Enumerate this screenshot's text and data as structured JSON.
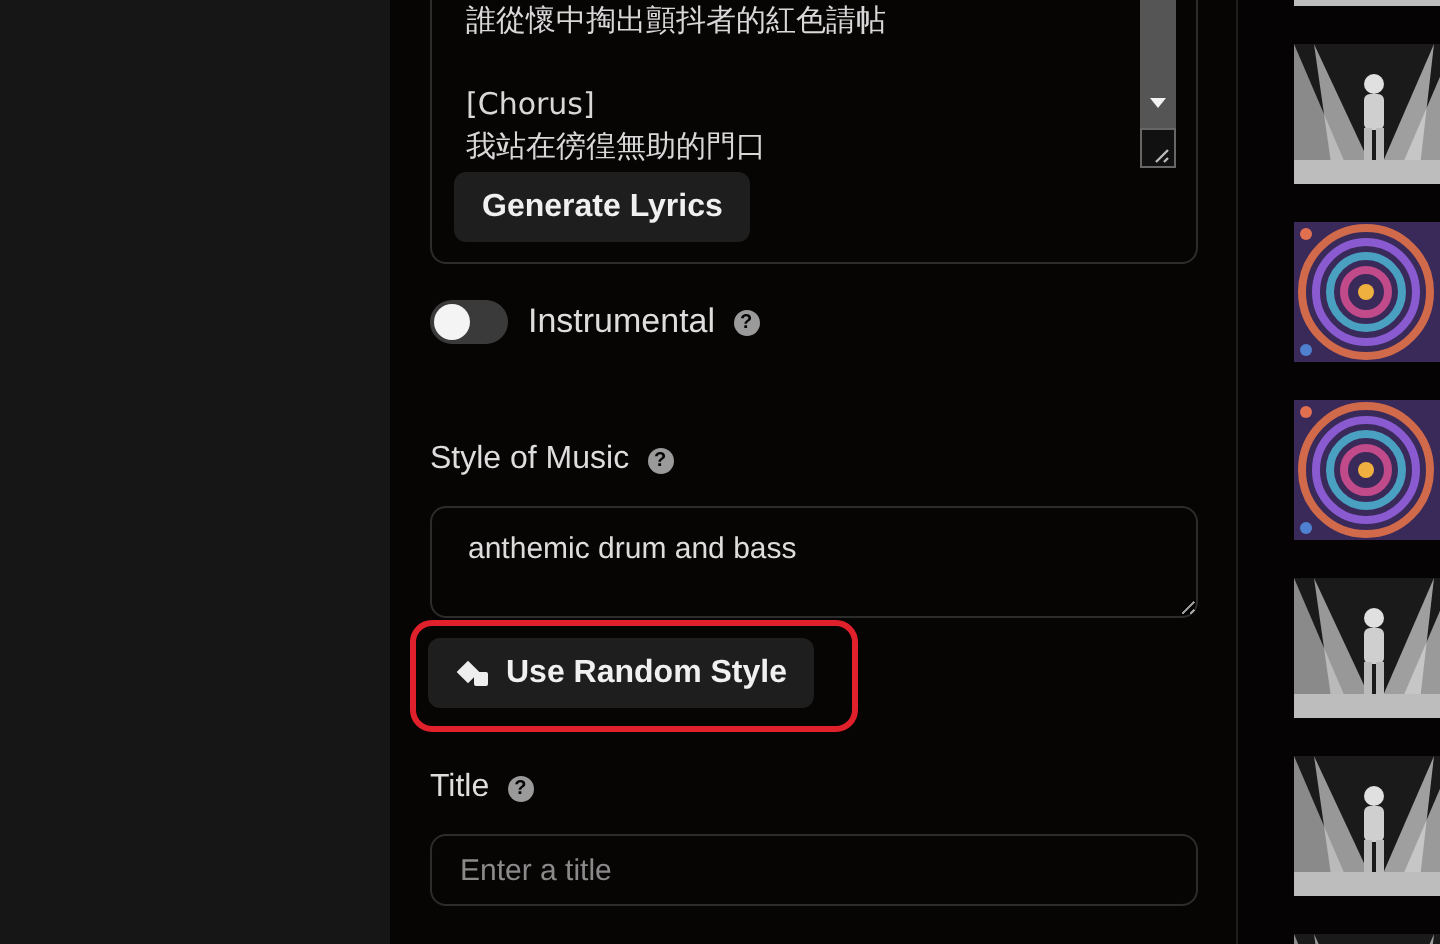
{
  "lyrics": {
    "stanzas": [
      [
        "誰從懷中掏出顫抖者的紅色請帖"
      ],
      [
        "[Chorus]",
        "我站在徬徨無助的門口"
      ]
    ],
    "button": "Generate Lyrics"
  },
  "instrumental": {
    "label": "Instrumental",
    "help": "?",
    "on": false
  },
  "style_of_music": {
    "label": "Style of Music",
    "help": "?",
    "value": "anthemic drum and bass"
  },
  "random_style_button": {
    "label": "Use Random Style",
    "highlighted": true
  },
  "title": {
    "label": "Title",
    "help": "?",
    "placeholder": "Enter a title"
  }
}
